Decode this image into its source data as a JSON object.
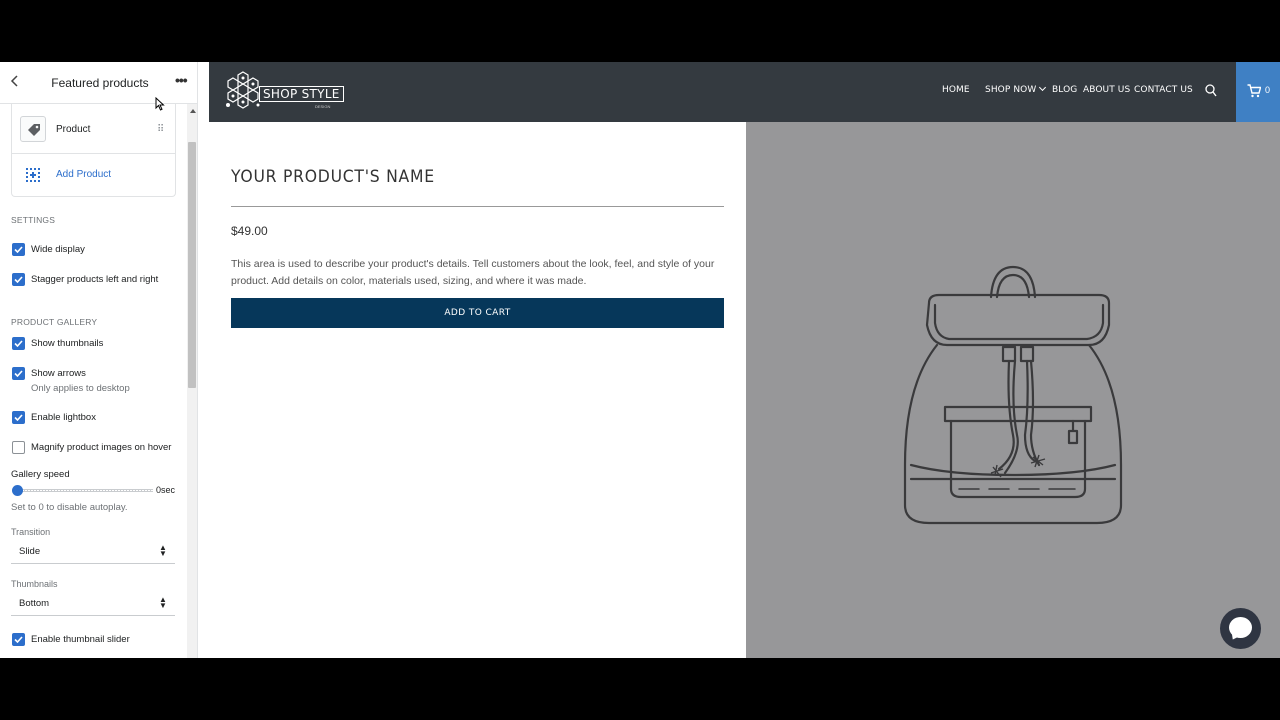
{
  "sidebar": {
    "title": "Featured products",
    "blocks": [
      {
        "label": "Product",
        "icon": "tag-icon"
      }
    ],
    "add_block_label": "Add Product",
    "settings_heading": "SETTINGS",
    "settings": [
      {
        "label": "Wide display",
        "checked": true
      },
      {
        "label": "Stagger products left and right",
        "checked": true
      }
    ],
    "gallery_heading": "PRODUCT GALLERY",
    "gallery_options": [
      {
        "label": "Show thumbnails",
        "checked": true
      },
      {
        "label": "Show arrows",
        "checked": true,
        "help": "Only applies to desktop"
      },
      {
        "label": "Enable lightbox",
        "checked": true
      },
      {
        "label": "Magnify product images on hover",
        "checked": false
      }
    ],
    "gallery_speed": {
      "label": "Gallery speed",
      "value": "0sec",
      "level": 0,
      "help": "Set to 0 to disable autoplay."
    },
    "transition": {
      "label": "Transition",
      "value": "Slide"
    },
    "thumbnails": {
      "label": "Thumbnails",
      "value": "Bottom"
    },
    "thumbnail_slider": {
      "label": "Enable thumbnail slider",
      "checked": true
    }
  },
  "store": {
    "logo_text": "SHOP STYLE",
    "logo_sub": "DESIGN",
    "nav": [
      "HOME",
      "SHOP NOW",
      "BLOG",
      "ABOUT US",
      "CONTACT US"
    ],
    "cart_count": "0"
  },
  "product": {
    "name": "YOUR PRODUCT'S NAME",
    "price": "$49.00",
    "description": "This area is used to describe your product's details. Tell customers about the look, feel, and style of your product. Add details on color, materials used, sizing, and where it was made.",
    "add_to_cart": "ADD TO CART"
  },
  "colors": {
    "accent": "#2c6ecb",
    "header_bg": "#343a40",
    "button_bg": "#06375a",
    "cart_bg": "#3f80c4",
    "image_bg": "#979799"
  }
}
